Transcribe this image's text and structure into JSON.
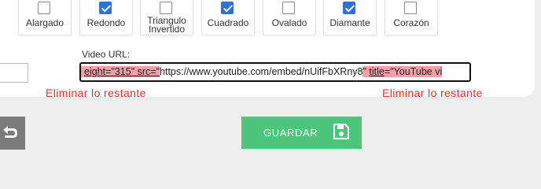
{
  "shapes": [
    {
      "label": "Alargado",
      "checked": false
    },
    {
      "label": "Redondo",
      "checked": true
    },
    {
      "label": "Triangulo Invertido",
      "checked": false
    },
    {
      "label": "Cuadrado",
      "checked": true
    },
    {
      "label": "Ovalado",
      "checked": false
    },
    {
      "label": "Diamante",
      "checked": true
    },
    {
      "label": "Corazón",
      "checked": false
    }
  ],
  "video": {
    "label": "Video URL:",
    "value_parts": {
      "before": "eight=\"315\" src=\"",
      "url": "https://www.youtube.com/embed/nUifFbXRny8",
      "after_quote": "\" ",
      "title_attr": "title",
      "title_value": "=\"YouTube vi"
    }
  },
  "annotations": {
    "left_note": "Eliminar lo restante",
    "right_note": "Eliminar lo restante",
    "highlight_color": "#f3a1a6",
    "note_color": "#e4312e"
  },
  "buttons": {
    "back_icon": "undo-arrow-icon",
    "save_label": "GUARDAR",
    "save_icon": "floppy-disk-icon",
    "save_color": "#4dc57a"
  }
}
